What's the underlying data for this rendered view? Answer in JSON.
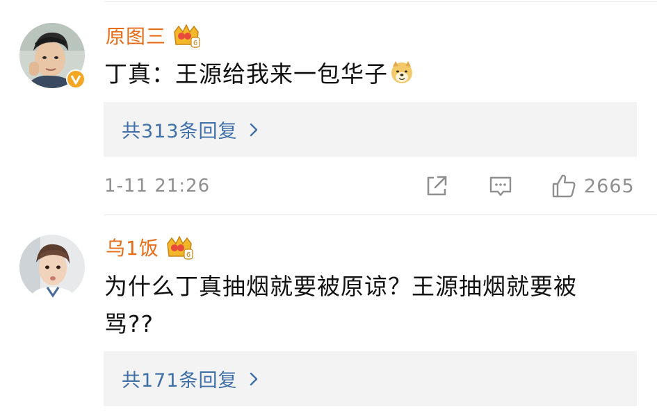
{
  "comments": [
    {
      "username": "原图三",
      "verified": true,
      "text": "丁真：王源给我来一包华子",
      "emoji": "doge-emoji",
      "replies_label": "共313条回复",
      "timestamp": "1-11 21:26",
      "likes": "2665"
    },
    {
      "username": "乌1饭",
      "verified": false,
      "text_line1": "为什么丁真抽烟就要被原谅？王源抽烟就要被",
      "text_line2": "骂??",
      "replies_label": "共171条回复"
    }
  ],
  "colors": {
    "username": "#e86b16",
    "link": "#3f6fa8",
    "meta": "#8f8f8f",
    "reply_bg": "#f3f3f3",
    "verified_badge": "#f5a623"
  },
  "icons": [
    "crown-badge-icon",
    "verified-badge-icon",
    "doge-emoji",
    "chevron-right-icon",
    "share-icon",
    "comment-icon",
    "thumbs-up-icon"
  ]
}
